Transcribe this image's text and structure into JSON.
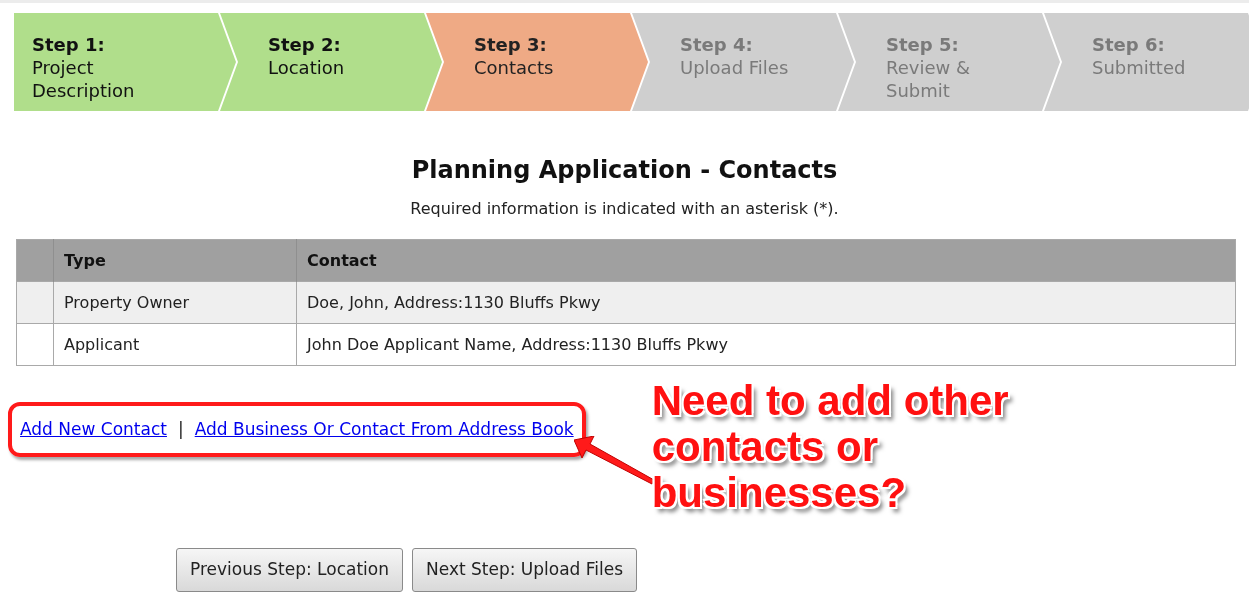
{
  "steps": [
    {
      "label": "Step 1:",
      "name": "Project Description",
      "completed": true,
      "selected": false
    },
    {
      "label": "Step 2:",
      "name": "Location",
      "completed": true,
      "selected": false
    },
    {
      "label": "Step 3:",
      "name": "Contacts",
      "completed": false,
      "selected": true
    },
    {
      "label": "Step 4:",
      "name": "Upload Files",
      "completed": false,
      "selected": false
    },
    {
      "label": "Step 5:",
      "name": "Review & Submit",
      "completed": false,
      "selected": false
    },
    {
      "label": "Step 6:",
      "name": "Submitted",
      "completed": false,
      "selected": false
    }
  ],
  "heading": "Planning Application - Contacts",
  "note": "Required information is indicated with an asterisk (*).",
  "table": {
    "columns": [
      "Type",
      "Contact"
    ],
    "rows": [
      {
        "type": "Property Owner",
        "contact": "Doe, John, Address:1130 Bluffs Pkwy"
      },
      {
        "type": "Applicant",
        "contact": "John Doe Applicant Name, Address:1130 Bluffs Pkwy"
      }
    ]
  },
  "links": [
    "Add New Contact",
    "|",
    "Add Business Or Contact From Address Book"
  ],
  "callout": "Need to add other contacts or businesses?",
  "buttons": [
    "Previous Step: Location",
    "Next Step: Upload Files"
  ]
}
